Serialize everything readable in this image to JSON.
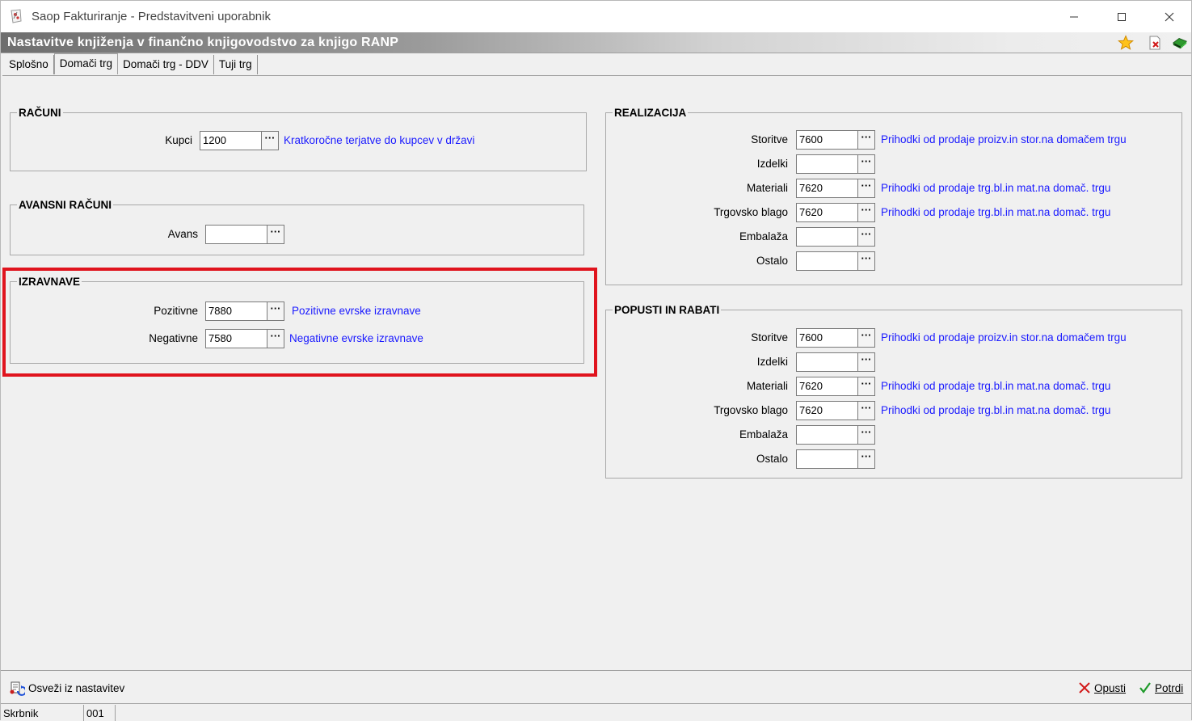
{
  "window": {
    "title": "Saop Fakturiranje - Predstavitveni uporabnik"
  },
  "header": {
    "title": "Nastavitve knjiženja v finančno knjigovodstvo za knjigo RANP"
  },
  "tabs": [
    {
      "label": "Splošno"
    },
    {
      "label": "Domači trg"
    },
    {
      "label": "Domači trg - DDV"
    },
    {
      "label": "Tuji trg"
    }
  ],
  "racuni": {
    "title": "RAČUNI",
    "kupci": {
      "label": "Kupci",
      "value": "1200",
      "desc": "Kratkoročne terjatve do kupcev v državi"
    }
  },
  "avansni": {
    "title": "AVANSNI RAČUNI",
    "avans": {
      "label": "Avans",
      "value": "",
      "desc": ""
    }
  },
  "izravnave": {
    "title": "IZRAVNAVE",
    "pozitivne": {
      "label": "Pozitivne",
      "value": "7880",
      "desc": "Pozitivne evrske izravnave"
    },
    "negativne": {
      "label": "Negativne",
      "value": "7580",
      "desc": "Negativne evrske izravnave"
    }
  },
  "realizacija": {
    "title": "REALIZACIJA",
    "rows": [
      {
        "label": "Storitve",
        "value": "7600",
        "desc": "Prihodki od prodaje proizv.in stor.na domačem trgu"
      },
      {
        "label": "Izdelki",
        "value": "",
        "desc": ""
      },
      {
        "label": "Materiali",
        "value": "7620",
        "desc": "Prihodki od prodaje trg.bl.in mat.na domač. trgu"
      },
      {
        "label": "Trgovsko blago",
        "value": "7620",
        "desc": "Prihodki od prodaje trg.bl.in mat.na domač. trgu"
      },
      {
        "label": "Embalaža",
        "value": "",
        "desc": ""
      },
      {
        "label": "Ostalo",
        "value": "",
        "desc": ""
      }
    ]
  },
  "popusti": {
    "title": "POPUSTI IN RABATI",
    "rows": [
      {
        "label": "Storitve",
        "value": "7600",
        "desc": "Prihodki od prodaje proizv.in stor.na domačem trgu"
      },
      {
        "label": "Izdelki",
        "value": "",
        "desc": ""
      },
      {
        "label": "Materiali",
        "value": "7620",
        "desc": "Prihodki od prodaje trg.bl.in mat.na domač. trgu"
      },
      {
        "label": "Trgovsko blago",
        "value": "7620",
        "desc": "Prihodki od prodaje trg.bl.in mat.na domač. trgu"
      },
      {
        "label": "Embalaža",
        "value": "",
        "desc": ""
      },
      {
        "label": "Ostalo",
        "value": "",
        "desc": ""
      }
    ]
  },
  "bottom": {
    "refresh_label": "Osveži iz nastavitev",
    "cancel_label": "Opusti",
    "confirm_label": "Potrdi"
  },
  "status": {
    "user": "Skrbnik",
    "code": "001"
  },
  "dots_glyph": "···"
}
